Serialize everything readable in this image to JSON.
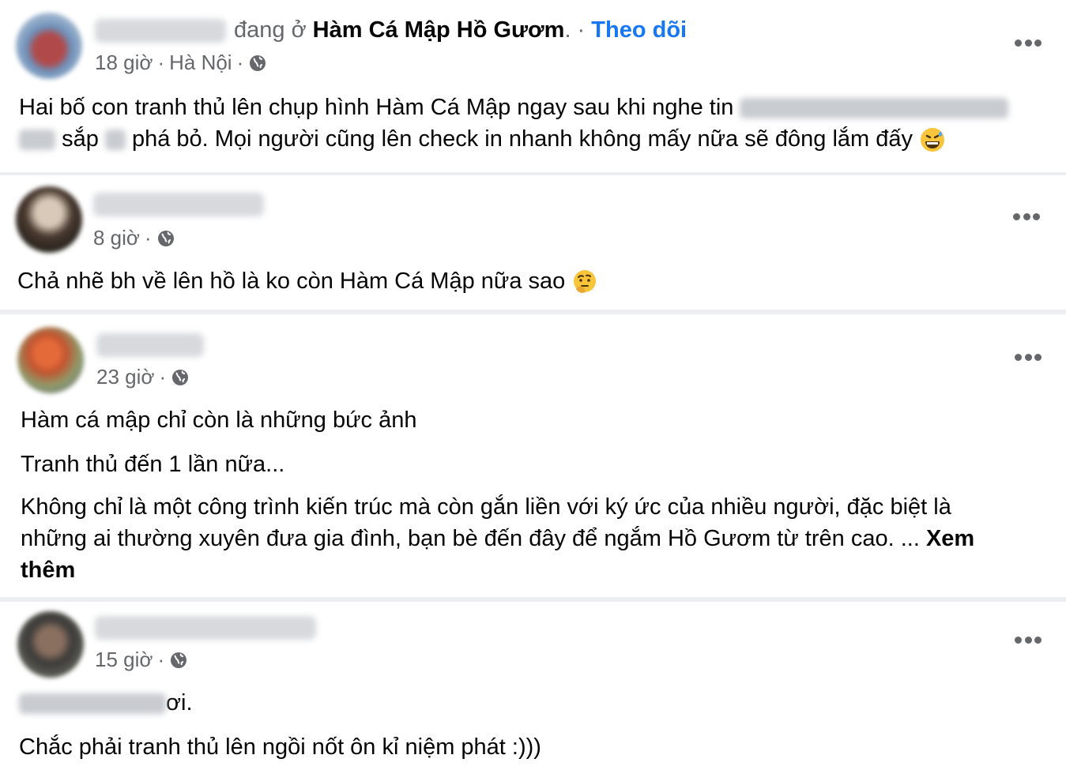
{
  "posts": [
    {
      "time": "18 giờ",
      "location": "Hà Nội",
      "dot": "·",
      "checkin_prefix": "đang ở",
      "place": "Hàm Cá Mập Hồ Gươm",
      "period_dot": ". ·",
      "follow": "Theo dõi",
      "line1": "Hai bố con tranh thủ lên chụp hình Hàm Cá Mập ngay sau khi nghe tin",
      "line2_a": "sắp",
      "line2_b": "phá bỏ. Mọi người cũng lên check in nhanh không mấy nữa sẽ đông lắm đấy",
      "emoji": "grinning-sweat"
    },
    {
      "time": "8 giờ",
      "dot": "·",
      "line1": "Chả nhẽ bh về lên hồ là ko còn Hàm Cá Mập nữa sao",
      "emoji": "thinking"
    },
    {
      "time": "23 giờ",
      "dot": "·",
      "p1": "Hàm cá mập chỉ còn là những bức ảnh",
      "p2": "Tranh thủ đến 1 lần nữa...",
      "p3_line1": "Không chỉ là một công trình kiến trúc mà còn gắn liền với ký ức của nhiều người, đặc biệt là",
      "p3_line2": "những ai thường xuyên đưa gia đình, bạn bè đến đây để ngắm Hồ Gươm từ trên cao.  ...",
      "see_more_1": "Xem",
      "see_more_2": "thêm"
    },
    {
      "time": "15 giờ",
      "dot": "·",
      "line1_end": "ơi.",
      "line2": "Chắc phải tranh thủ lên ngồi nốt ôn kỉ niệm phát :)))"
    }
  ],
  "icons": {
    "globe": "globe-icon",
    "more": "more-options-icon"
  },
  "colors": {
    "link": "#1877f2",
    "meta": "#65676b",
    "background": "#eceef1"
  }
}
